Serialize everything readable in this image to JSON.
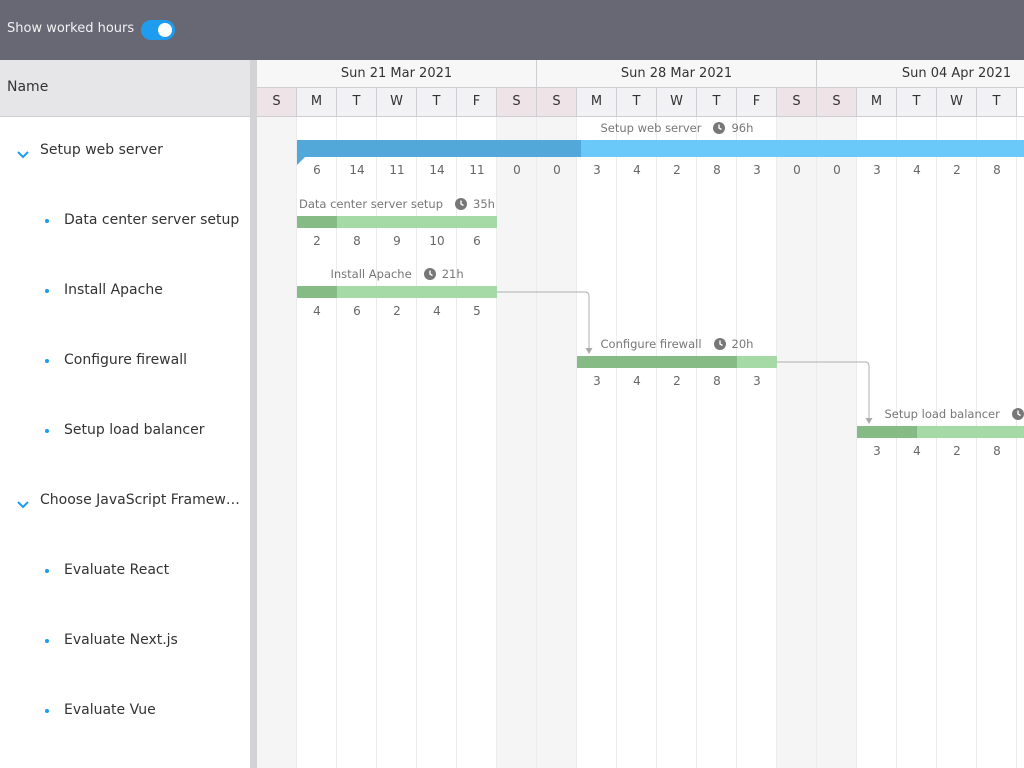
{
  "toolbar": {
    "label": "Show worked hours",
    "toggle_on": true
  },
  "grid": {
    "name_header": "Name"
  },
  "timeline": {
    "weeks": [
      "Sun 21 Mar 2021",
      "Sun 28 Mar 2021",
      "Sun 04 Apr 2021"
    ],
    "days": [
      "S",
      "M",
      "T",
      "W",
      "T",
      "F",
      "S",
      "S",
      "M",
      "T",
      "W",
      "T",
      "F",
      "S",
      "S",
      "M",
      "T",
      "W",
      "T"
    ]
  },
  "rows": [
    {
      "name": "Setup web server",
      "kind": "parent",
      "bar": {
        "start": 1,
        "span": 19,
        "progress": 7.1,
        "label": "Setup web server",
        "hours": "96h"
      },
      "hours_start": 1,
      "hours": [
        "6",
        "14",
        "11",
        "14",
        "11",
        "0",
        "0",
        "3",
        "4",
        "2",
        "8",
        "3",
        "0",
        "0",
        "3",
        "4",
        "2",
        "8"
      ]
    },
    {
      "name": "Data center server setup",
      "kind": "child",
      "bar": {
        "start": 1,
        "span": 5,
        "progress": 1,
        "label": "Data center server setup",
        "hours": "35h"
      },
      "hours_start": 1,
      "hours": [
        "2",
        "8",
        "9",
        "10",
        "6"
      ]
    },
    {
      "name": "Install Apache",
      "kind": "child",
      "bar": {
        "start": 1,
        "span": 5,
        "progress": 1,
        "label": "Install Apache",
        "hours": "21h"
      },
      "hours_start": 1,
      "hours": [
        "4",
        "6",
        "2",
        "4",
        "5"
      ]
    },
    {
      "name": "Configure firewall",
      "kind": "child",
      "bar": {
        "start": 8,
        "span": 5,
        "progress": 4,
        "label": "Configure firewall",
        "hours": "20h"
      },
      "hours_start": 8,
      "hours": [
        "3",
        "4",
        "2",
        "8",
        "3"
      ]
    },
    {
      "name": "Setup load balancer",
      "kind": "child",
      "bar": {
        "start": 15,
        "span": 5,
        "progress": 1.5,
        "label": "Setup load balancer",
        "hours": ""
      },
      "hours_start": 15,
      "hours": [
        "3",
        "4",
        "2",
        "8"
      ]
    },
    {
      "name": "Choose JavaScript Framework",
      "kind": "parent"
    },
    {
      "name": "Evaluate React",
      "kind": "child"
    },
    {
      "name": "Evaluate Next.js",
      "kind": "child"
    },
    {
      "name": "Evaluate Vue",
      "kind": "child"
    }
  ],
  "colors": {
    "accent": "#1e9cf0",
    "parent_bar": "#6bc9fa",
    "parent_progress": "#52a8d8",
    "child_bar": "#a5d9a5",
    "child_progress": "#86bb86",
    "toolbar_bg": "#676874"
  }
}
